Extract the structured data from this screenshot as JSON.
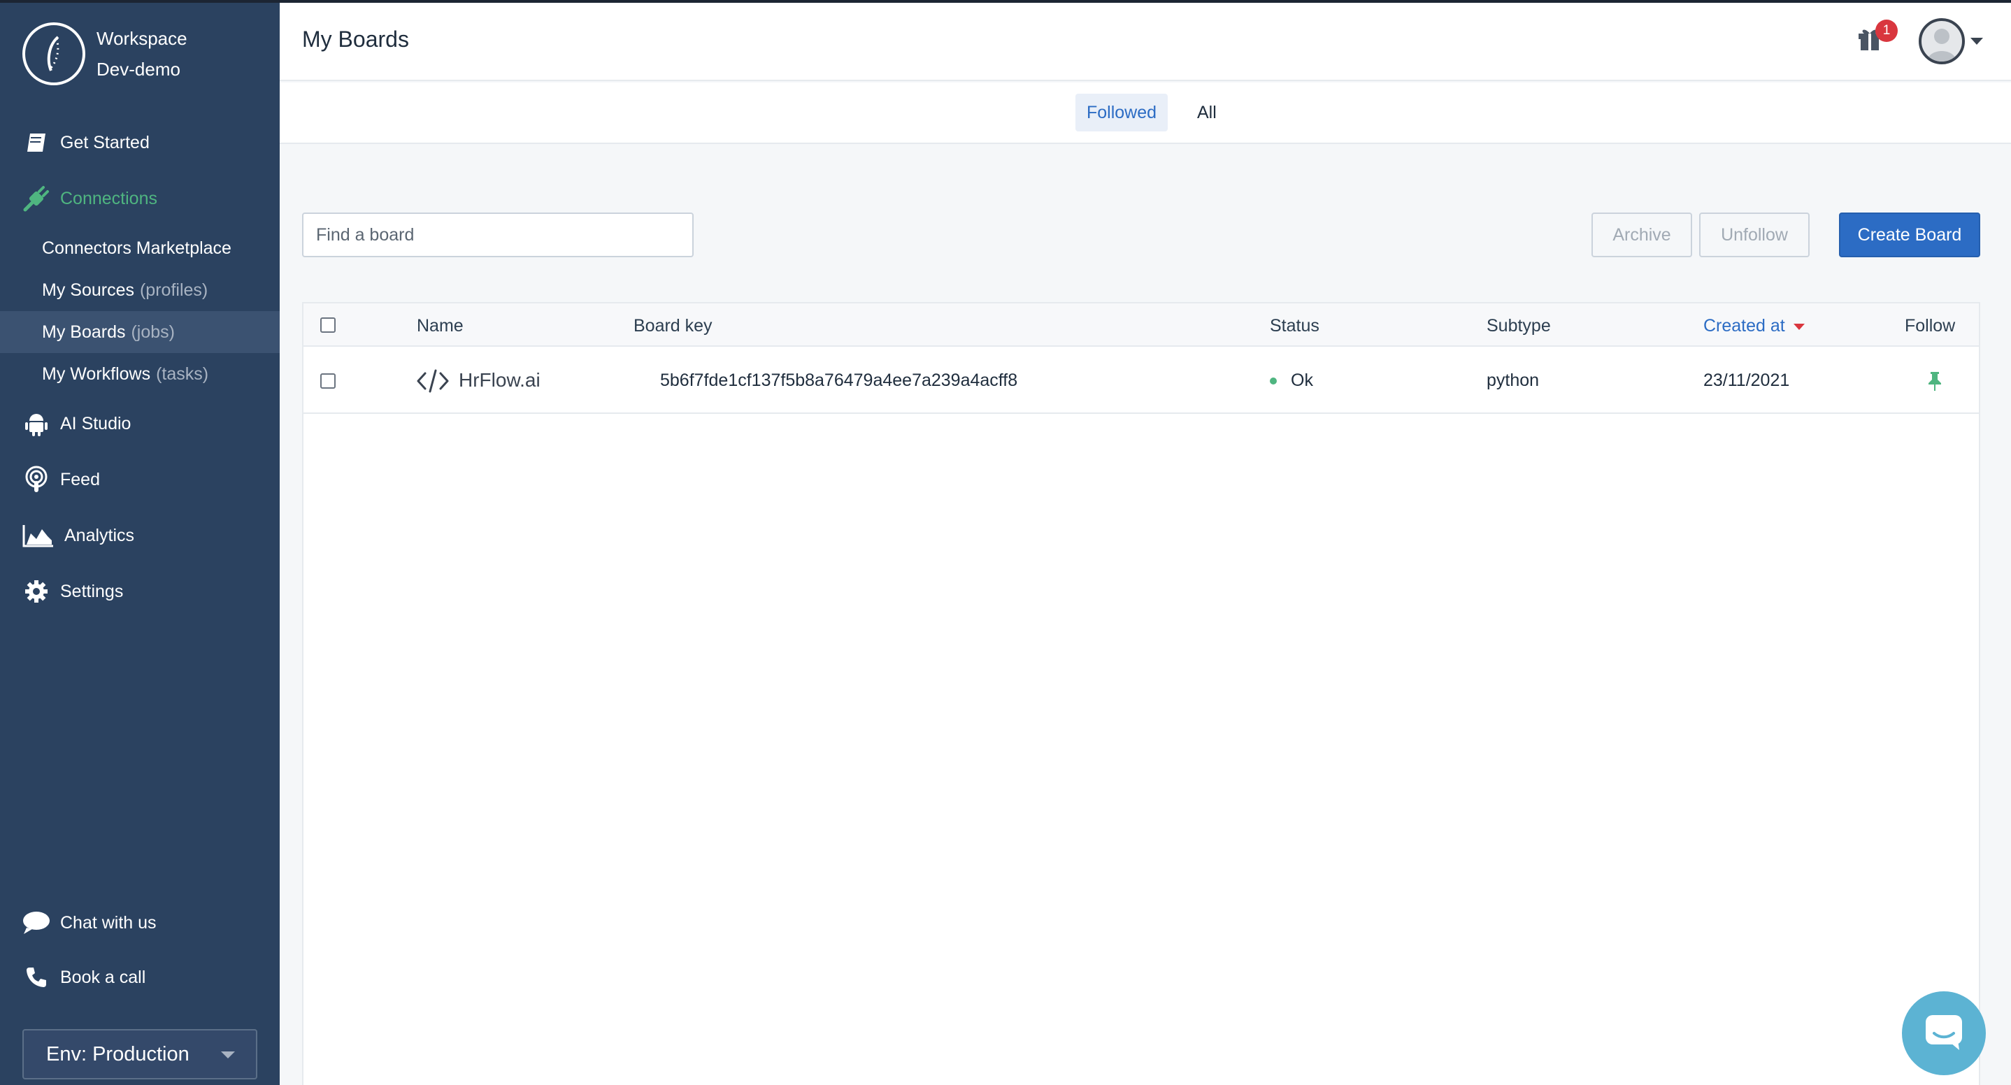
{
  "workspace": {
    "label": "Workspace",
    "name": "Dev-demo"
  },
  "sidebar": {
    "items": [
      {
        "label": "Get Started",
        "icon": "book-icon"
      },
      {
        "label": "Connections",
        "icon": "plug-icon"
      },
      {
        "label": "AI Studio",
        "icon": "android-icon"
      },
      {
        "label": "Feed",
        "icon": "podcast-icon"
      },
      {
        "label": "Analytics",
        "icon": "area-chart-icon"
      },
      {
        "label": "Settings",
        "icon": "gear-icon"
      }
    ],
    "sub_items": [
      {
        "label": "Connectors Marketplace",
        "suffix": ""
      },
      {
        "label": "My Sources",
        "suffix": "(profiles)"
      },
      {
        "label": "My Boards",
        "suffix": "(jobs)"
      },
      {
        "label": "My Workflows",
        "suffix": "(tasks)"
      }
    ],
    "bottom": [
      {
        "label": "Chat with us",
        "icon": "chat-icon"
      },
      {
        "label": "Book a call",
        "icon": "phone-icon"
      }
    ],
    "env_select": "Env: Production"
  },
  "header": {
    "title": "My Boards",
    "notification_count": "1"
  },
  "tabs": [
    {
      "label": "Followed"
    },
    {
      "label": "All"
    }
  ],
  "toolbar": {
    "search_placeholder": "Find a board",
    "archive_label": "Archive",
    "unfollow_label": "Unfollow",
    "create_label": "Create Board"
  },
  "table": {
    "columns": [
      "Name",
      "Board key",
      "Status",
      "Subtype",
      "Created at",
      "Follow"
    ],
    "rows": [
      {
        "name": "HrFlow.ai",
        "board_key": "5b6f7fde1cf137f5b8a76479a4ee7a239a4acff8",
        "status": "Ok",
        "subtype": "python",
        "created_at": "23/11/2021"
      }
    ]
  },
  "colors": {
    "sidebar": "#2b4260",
    "accent": "#2c6cc4",
    "active_green": "#4fb580",
    "badge": "#d9363e"
  }
}
